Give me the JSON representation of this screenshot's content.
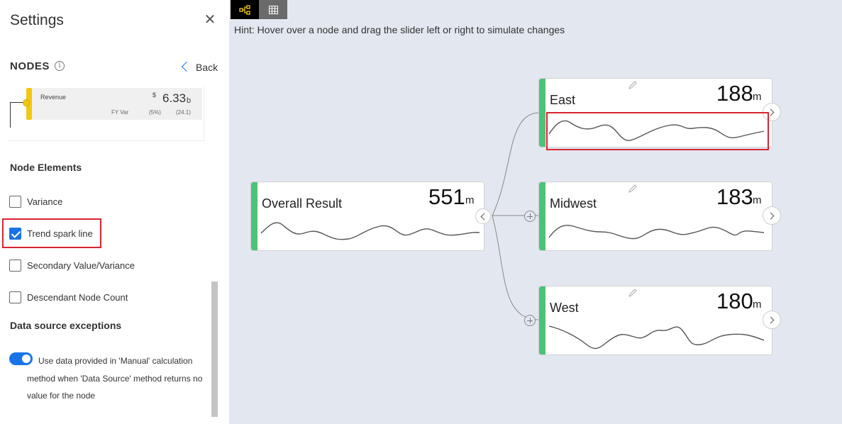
{
  "panel": {
    "title": "Settings",
    "close_icon": "close-icon",
    "section": "NODES",
    "info_icon": "info-icon",
    "back_label": "Back",
    "preview": {
      "name": "Revenue",
      "currency": "$",
      "value": "6.33",
      "unit": "b",
      "fy_var_label": "FY Var",
      "fy_var_pct": "(5%)",
      "fy_var_diff": "(24.1)"
    },
    "node_elements_heading": "Node Elements",
    "checkboxes": [
      {
        "label": "Variance",
        "checked": false
      },
      {
        "label": "Trend spark line",
        "checked": true
      },
      {
        "label": "Secondary Value/Variance",
        "checked": false
      },
      {
        "label": "Descendant Node Count",
        "checked": false
      }
    ],
    "exceptions_heading": "Data source exceptions",
    "toggle_on": true,
    "toggle_text": "Use data provided in 'Manual' calculation method when 'Data Source' method returns no value for the node"
  },
  "canvas": {
    "hint": "Hint: Hover over a node and drag the slider left or right to simulate changes",
    "toolbar": {
      "tree_icon": "tree-icon",
      "table_icon": "table-icon"
    },
    "colors": {
      "node_bar": "#4ec07a",
      "highlight": "#d9242f",
      "canvas_bg": "#e3e8f0"
    },
    "nodes": [
      {
        "name": "Overall Result",
        "value": "551",
        "unit": "m"
      },
      {
        "name": "East",
        "value": "188",
        "unit": "m"
      },
      {
        "name": "Midwest",
        "value": "183",
        "unit": "m"
      },
      {
        "name": "West",
        "value": "180",
        "unit": "m"
      }
    ]
  }
}
